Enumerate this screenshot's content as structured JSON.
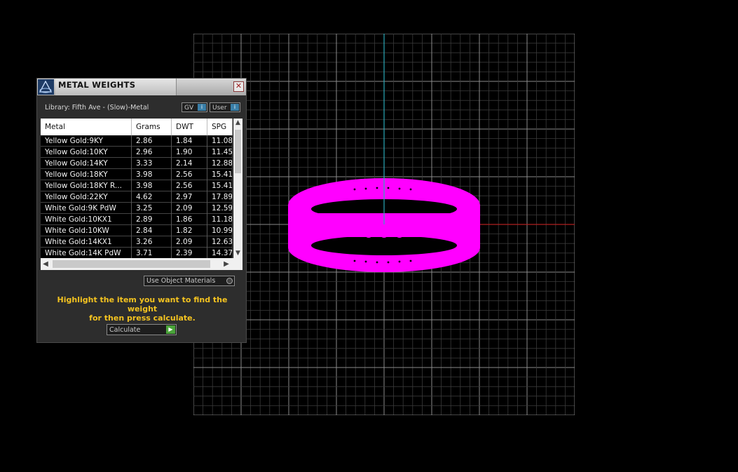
{
  "panel": {
    "title": "METAL WEIGHTS",
    "close_label": "✕",
    "library_label": "Library: Fifth Ave - (Slow)-Metal",
    "gv_label": "GV",
    "user_label": "User",
    "use_object_materials_label": "Use Object Materials",
    "hint_line1": "Highlight the item you want to find the weight",
    "hint_line2": "for then press calculate.",
    "calculate_label": "Calculate"
  },
  "table": {
    "headers": [
      "Metal",
      "Grams",
      "DWT",
      "SPG"
    ],
    "rows": [
      [
        "Yellow Gold:9KY",
        "2.86",
        "1.84",
        "11.08"
      ],
      [
        "Yellow Gold:10KY",
        "2.96",
        "1.90",
        "11.45"
      ],
      [
        "Yellow Gold:14KY",
        "3.33",
        "2.14",
        "12.88"
      ],
      [
        "Yellow Gold:18KY",
        "3.98",
        "2.56",
        "15.41"
      ],
      [
        "Yellow Gold:18KY R...",
        "3.98",
        "2.56",
        "15.41"
      ],
      [
        "Yellow Gold:22KY",
        "4.62",
        "2.97",
        "17.89"
      ],
      [
        "White Gold:9K PdW",
        "3.25",
        "2.09",
        "12.59"
      ],
      [
        "White Gold:10KX1",
        "2.89",
        "1.86",
        "11.18"
      ],
      [
        "White Gold:10KW",
        "2.84",
        "1.82",
        "10.99"
      ],
      [
        "White Gold:14KX1",
        "3.26",
        "2.09",
        "12.63"
      ],
      [
        "White Gold:14K PdW",
        "3.71",
        "2.39",
        "14.37"
      ]
    ]
  },
  "viewport": {
    "ring_color": "#ff00ff",
    "grid_color": "#5a5a5a",
    "y_axis_color": "#2aa8b8",
    "x_axis_color": "#b02020"
  }
}
